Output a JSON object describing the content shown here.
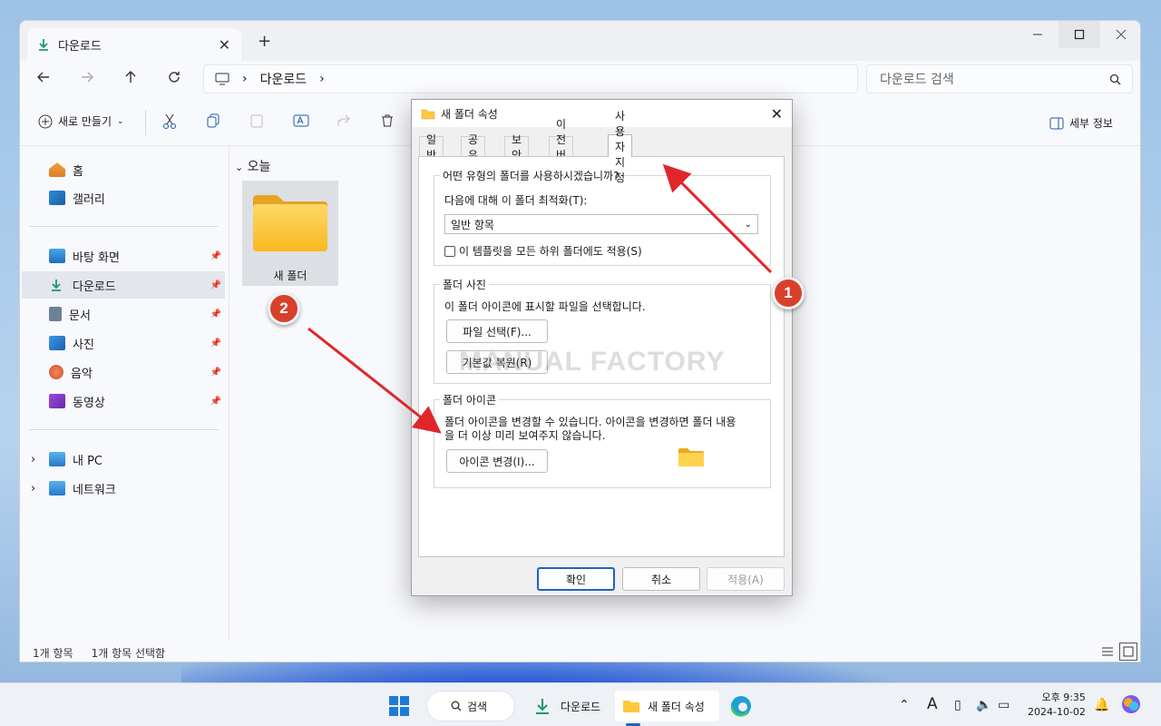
{
  "explorer": {
    "tab_title": "다운로드",
    "close_tab": "✕",
    "new_tab": "+",
    "address_location": "다운로드",
    "search_placeholder": "다운로드 검색",
    "new_button_label": "새로 만들기",
    "details_label": "세부 정보",
    "sidebar": {
      "home": "홈",
      "gallery": "갤러리",
      "desktop": "바탕 화면",
      "downloads": "다운로드",
      "documents": "문서",
      "pictures": "사진",
      "music": "음악",
      "videos": "동영상",
      "this_pc": "내 PC",
      "network": "네트워크"
    },
    "group_header": "오늘",
    "folder_name": "새 폴더",
    "status_count": "1개 항목",
    "status_selected": "1개 항목 선택함"
  },
  "dialog": {
    "title": "새 폴더 속성",
    "tabs": [
      "일반",
      "공유",
      "보안",
      "이전 버전",
      "사용자 지정"
    ],
    "active_tab": "사용자 지정",
    "folder_type_group": "어떤 유형의 폴더를 사용하시겠습니까?",
    "optimize_label": "다음에 대해 이 폴더 최적화(T):",
    "optimize_value": "일반 항목",
    "apply_template_label": "이 템플릿을 모든 하위 폴더에도 적용(S)",
    "folder_picture_group": "폴더 사진",
    "folder_picture_desc": "이 폴더 아이콘에 표시할 파일을 선택합니다.",
    "choose_file_button": "파일 선택(F)...",
    "restore_default_button": "기본값 복원(R)",
    "folder_icon_group": "폴더 아이콘",
    "folder_icon_desc_line1": "폴더 아이콘을 변경할 수 있습니다. 아이콘을 변경하면 폴더 내용",
    "folder_icon_desc_line2": "을 더 이상  미리 보여주지 않습니다.",
    "change_icon_button": "아이콘 변경(I)...",
    "ok_button": "확인",
    "cancel_button": "취소",
    "apply_button": "적용(A)"
  },
  "annotations": {
    "badge1": "1",
    "badge2": "2",
    "watermark": "MANUAL FACTORY",
    "arrow_color": "#e0262a"
  },
  "taskbar": {
    "search_label": "검색",
    "downloads_label": "다운로드",
    "properties_label": "새 폴더 속성",
    "time": "오후 9:35",
    "date": "2024-10-02"
  }
}
